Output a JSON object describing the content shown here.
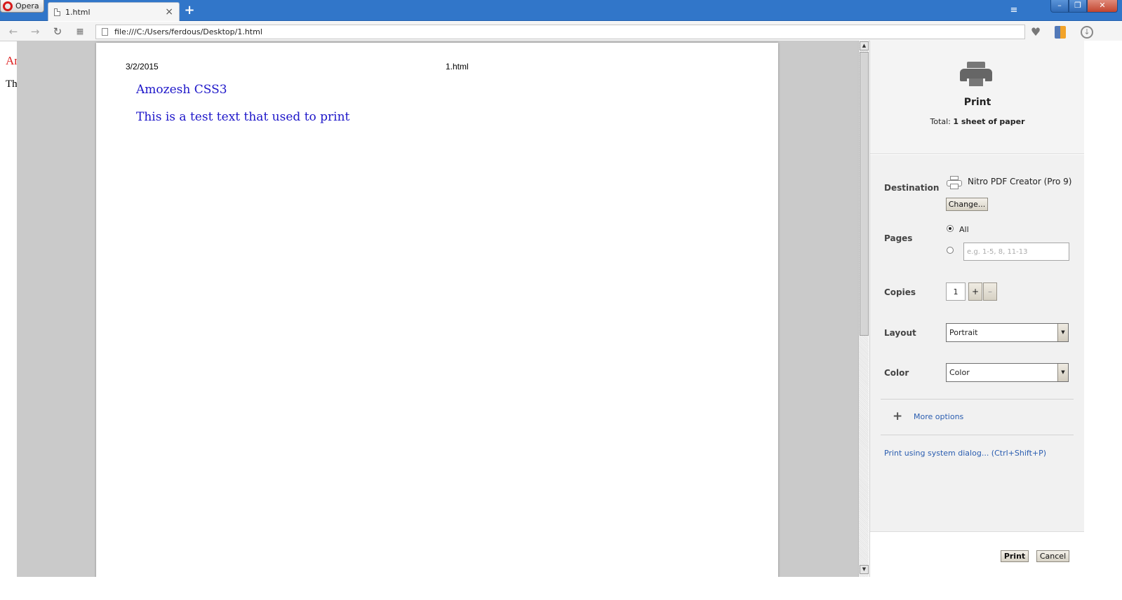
{
  "browser": {
    "menu_label": "Opera",
    "tab_title": "1.html",
    "tab_close": "×",
    "new_tab": "+",
    "url": "file:///C:/Users/ferdous/Desktop/1.html",
    "window_buttons": {
      "minimize": "–",
      "restore": "❐",
      "close": "✕"
    },
    "colors": {
      "titlebar": "#3176c9",
      "opera_red": "#d61a1a"
    }
  },
  "background_page": {
    "heading_fragment": "An",
    "text_fragment": "Th"
  },
  "preview": {
    "header_date": "3/2/2015",
    "header_title": "1.html",
    "heading": "Amozesh CSS3",
    "body_text": "This is a test text that used to print",
    "text_color": "#1d16c9"
  },
  "print_panel": {
    "title": "Print",
    "total_label": "Total:",
    "total_value": "1 sheet of paper",
    "destination": {
      "label": "Destination",
      "printer_name": "Nitro PDF Creator (Pro 9)",
      "change_button": "Change..."
    },
    "pages": {
      "label": "Pages",
      "option_all": "All",
      "range_placeholder": "e.g. 1-5, 8, 11-13",
      "selected": "All"
    },
    "copies": {
      "label": "Copies",
      "value": "1",
      "plus": "+",
      "minus": "–"
    },
    "layout": {
      "label": "Layout",
      "value": "Portrait"
    },
    "color": {
      "label": "Color",
      "value": "Color"
    },
    "more_options": "More options",
    "system_dialog_link": "Print using system dialog... (Ctrl+Shift+P)",
    "print_button": "Print",
    "cancel_button": "Cancel",
    "link_color": "#2a5db0"
  },
  "icons": {
    "back": "arrow-left-icon",
    "forward": "arrow-right-icon",
    "reload": "reload-icon",
    "speed_dial": "grid-icon",
    "page": "page-icon",
    "heart": "heart-icon",
    "bookmark": "book-icon",
    "download": "download-icon",
    "tab_menu": "tab-menu-icon",
    "printer": "printer-icon"
  }
}
